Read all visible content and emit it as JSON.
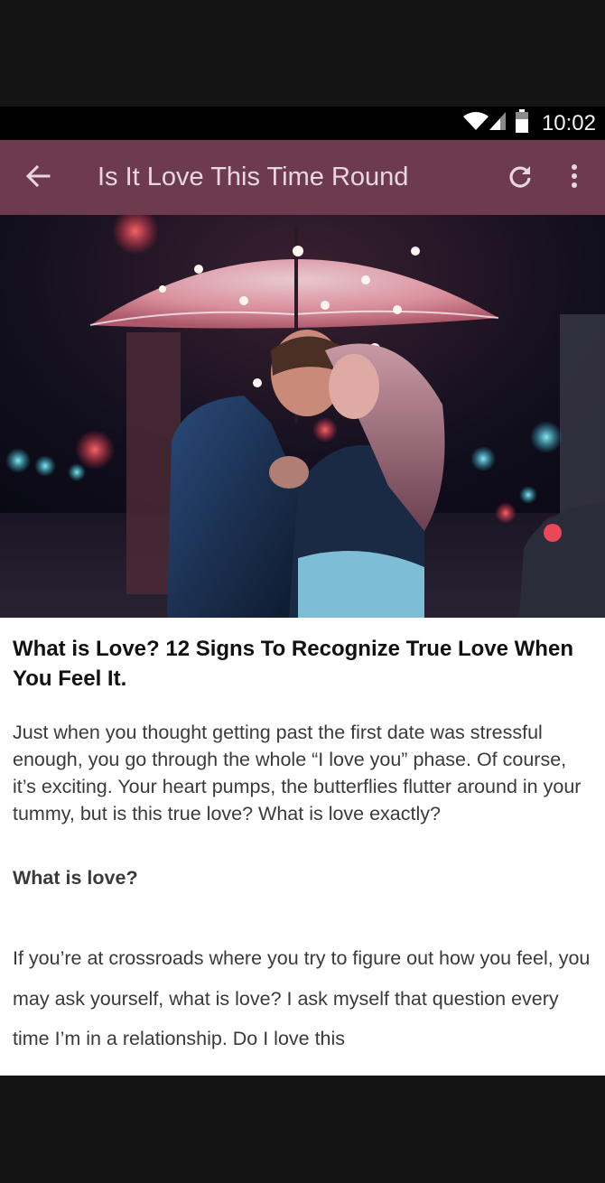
{
  "status_bar": {
    "time": "10:02",
    "icons": [
      "wifi-icon",
      "signal-icon",
      "battery-icon"
    ]
  },
  "app_bar": {
    "title": "Is It Love This Time Round",
    "background": "#6e3b4e",
    "icons": [
      "back-arrow-icon",
      "refresh-icon",
      "more-vert-icon"
    ]
  },
  "article": {
    "headline": "What is Love? 12 Signs To Recognize True Love When You Feel It.",
    "intro": "Just when you thought getting past the first date was stressful enough, you go through the whole “I love you” phase. Of course, it’s exciting. Your heart pumps, the butterflies flutter around in your tummy, but is this true love? What is love exactly?",
    "subheading": "What is love?",
    "body": "If you’re at crossroads where you try to figure out how you feel, you may ask yourself, what is love? I ask myself that question every time I’m in a relationship. Do I love this"
  }
}
